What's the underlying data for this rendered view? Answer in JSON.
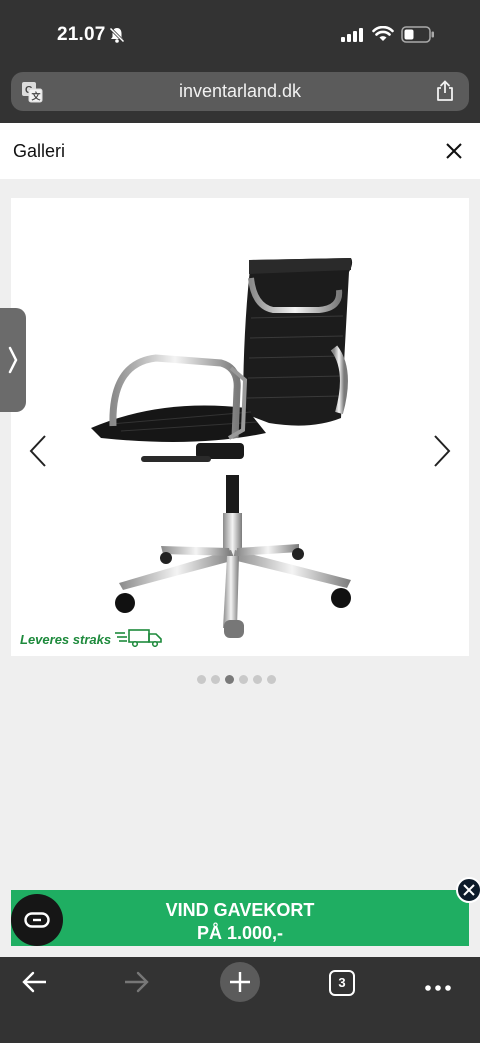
{
  "status_bar": {
    "time": "21.07",
    "icons": [
      "bell-slash-icon",
      "signal-icon",
      "wifi-icon",
      "battery-icon"
    ]
  },
  "browser": {
    "url": "inventarland.dk",
    "tab_count": "3",
    "icons": [
      "translate-icon",
      "share-icon",
      "back-icon",
      "forward-icon",
      "new-tab-icon",
      "more-icon"
    ]
  },
  "gallery": {
    "title": "Galleri",
    "delivery_badge": "Leveres straks",
    "slide_count": 6,
    "active_slide": 3
  },
  "promo": {
    "line1": "VIND GAVEKORT",
    "line2": "PÅ 1.000,-",
    "color": "#1fae62"
  },
  "colors": {
    "browser_chrome": "#333333",
    "url_field": "#5b5b5b",
    "delivery_green": "#1e8a3c"
  }
}
